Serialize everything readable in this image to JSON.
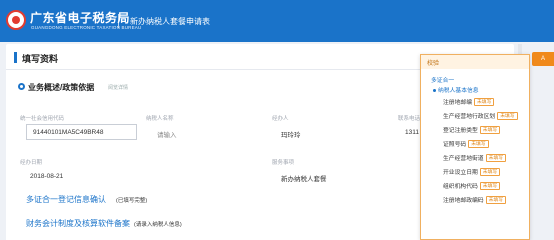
{
  "header": {
    "brand_cn": "广东省电子税务局",
    "brand_en": "GUANGDONG ELECTRONIC TAXATION BUREAU",
    "page_title": "新办纳税人套餐申请表"
  },
  "card": {
    "title": "填写资料",
    "section_title": "业务概述/政策依据",
    "section_note": "阅览详情"
  },
  "fields": {
    "credit_code_label": "统一社会信用代码",
    "credit_code_value": "91440101MA5C49BR48",
    "taxpayer_name_label": "纳税人名称",
    "taxpayer_name_value": "请输入",
    "operator_label": "经办人",
    "operator_value": "玛玲玲",
    "phone_label": "联系电话",
    "phone_value": "1311",
    "date_label": "经办日期",
    "date_value": "2018-08-21",
    "service_label": "服务事项",
    "service_value": "新办纳税人套餐"
  },
  "links": {
    "link1": "多证合一登记信息确认",
    "link1_note": "(已填写完整)",
    "link2": "财务会计制度及核算软件备案",
    "link2_note": "(请录入纳税人信息)"
  },
  "side": {
    "button_label": "A",
    "panel_title": "校验",
    "group": "多证合一",
    "subgroup": "纳税人基本信息",
    "tag": "未填写",
    "items": [
      "注册地邮编",
      "生产经营地行政区划",
      "登记注册类型",
      "证照号码",
      "生产经营地街道",
      "开业设立日期",
      "组织机构代码",
      "注册地邮政编码"
    ]
  }
}
